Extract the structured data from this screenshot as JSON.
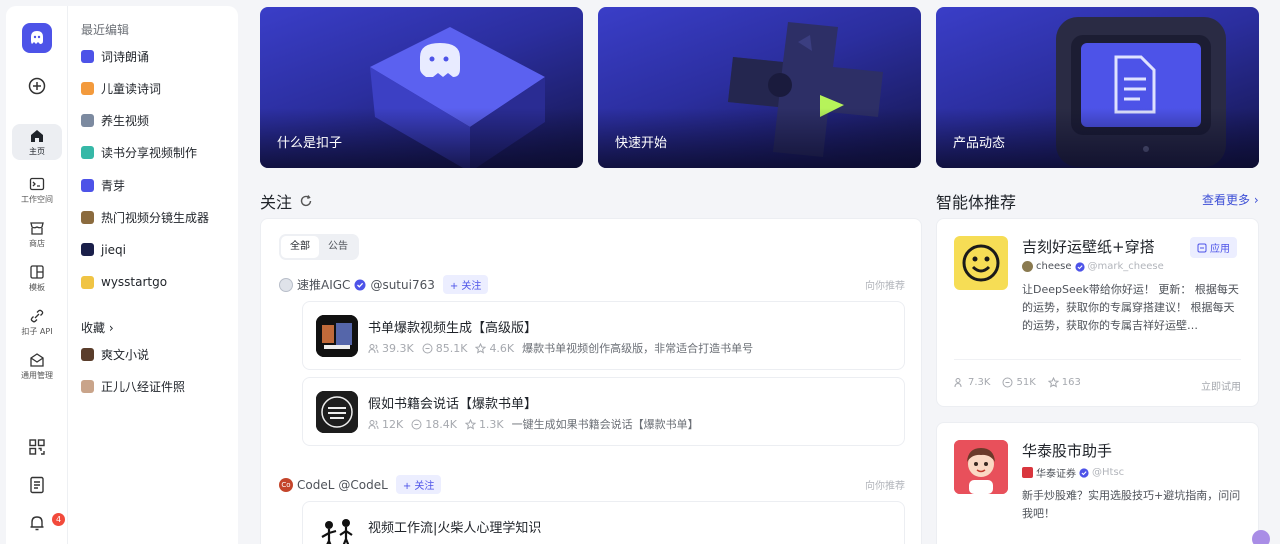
{
  "rail": {
    "items": [
      {
        "label": "主页",
        "icon": "home-icon",
        "active": true
      },
      {
        "label": "工作空间",
        "icon": "workspace-icon"
      },
      {
        "label": "商店",
        "icon": "store-icon"
      },
      {
        "label": "模板",
        "icon": "template-icon"
      },
      {
        "label": "扣子 API",
        "icon": "api-icon"
      },
      {
        "label": "通用管理",
        "icon": "management-icon"
      }
    ],
    "notification_count": "4"
  },
  "panel": {
    "recent_title": "最近编辑",
    "recent": [
      {
        "label": "词诗朗诵",
        "color": "#4d53e8"
      },
      {
        "label": "儿童读诗词",
        "color": "#f39a3c"
      },
      {
        "label": "养生视频",
        "color": "#7c8aa0"
      },
      {
        "label": "读书分享视频制作",
        "color": "#36b8a7"
      },
      {
        "label": "青芽",
        "color": "#4d53e8"
      },
      {
        "label": "热门视频分镜生成器",
        "color": "#8b6b3e"
      },
      {
        "label": "jieqi",
        "color": "#1a1f4a"
      },
      {
        "label": "wysstartgo",
        "color": "#f0c444"
      }
    ],
    "favorites_title": "收藏 ›",
    "favorites": [
      {
        "label": "爽文小说",
        "color": "#5a3d2b"
      },
      {
        "label": "正儿八经证件照",
        "color": "#c9a48a"
      }
    ]
  },
  "hero": [
    {
      "title": "什么是扣子"
    },
    {
      "title": "快速开始"
    },
    {
      "title": "产品动态"
    }
  ],
  "follow": {
    "title": "关注",
    "tabs": [
      "全部",
      "公告"
    ],
    "posts": [
      {
        "author": "速推AIGC",
        "handle": "@sutui763",
        "follow_label": "+ 关注",
        "note": "向你推荐",
        "bots": [
          {
            "title": "书单爆款视频生成【高级版】",
            "users": "39.3K",
            "chats": "85.1K",
            "stars": "4.6K",
            "desc": "爆款书单视频创作高级版，非常适合打造书单号"
          },
          {
            "title": "假如书籍会说话【爆款书单】",
            "users": "12K",
            "chats": "18.4K",
            "stars": "1.3K",
            "desc": "一键生成如果书籍会说话【爆款书单】"
          }
        ]
      },
      {
        "author": "CodeL",
        "handle": "@CodeL",
        "follow_label": "+ 关注",
        "note": "向你推荐",
        "bots": [
          {
            "title": "视频工作流|火柴人心理学知识",
            "users": "",
            "chats": "",
            "stars": "",
            "desc": ""
          }
        ]
      }
    ]
  },
  "agents": {
    "title": "智能体推荐",
    "more": "查看更多 ›",
    "cards": [
      {
        "name": "吉刻好运壁纸+穿搭",
        "author": "cheese",
        "handle": "@mark_cheese",
        "tag": "应用",
        "desc": "让DeepSeek带给你好运！ 更新： 根据每天的运势，获取你的专属穿搭建议！ 根据每天的运势，获取你的专属吉祥好运壁…",
        "users": "7.3K",
        "chats": "51K",
        "stars": "163",
        "try": "立即试用"
      },
      {
        "name": "华泰股市助手",
        "author": "华泰证券",
        "handle": "@Htsc",
        "desc": "新手炒股难？实用选股技巧+避坑指南，问问我吧！"
      }
    ]
  }
}
